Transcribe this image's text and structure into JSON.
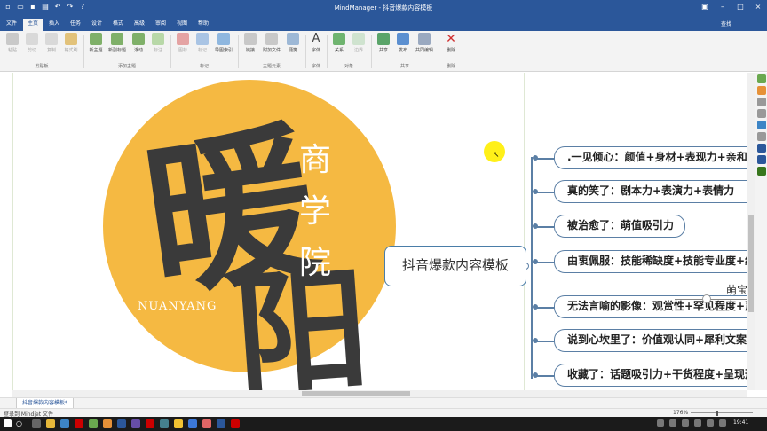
{
  "window": {
    "title": "MindManager - 抖音爆款内容模板"
  },
  "ribbon_tabs": [
    {
      "label": "文件"
    },
    {
      "label": "主页"
    },
    {
      "label": "插入"
    },
    {
      "label": "任务"
    },
    {
      "label": "设计"
    },
    {
      "label": "格式"
    },
    {
      "label": "高级"
    },
    {
      "label": "审阅"
    },
    {
      "label": "视图"
    },
    {
      "label": "帮助"
    }
  ],
  "find_label": "查找",
  "ribbon": {
    "buttons": [
      {
        "label": "粘贴"
      },
      {
        "label": "剪切"
      },
      {
        "label": "复制"
      },
      {
        "label": "格式刷"
      },
      {
        "label": "新主题"
      },
      {
        "label": "新副标题"
      },
      {
        "label": "浮动"
      },
      {
        "label": "标注"
      },
      {
        "label": "图标"
      },
      {
        "label": "标记"
      },
      {
        "label": "导图索引"
      },
      {
        "label": "链接"
      },
      {
        "label": "附加文件"
      },
      {
        "label": "便笺"
      },
      {
        "label": "字体"
      },
      {
        "label": "关系"
      },
      {
        "label": "边界"
      },
      {
        "label": "共享"
      },
      {
        "label": "发布"
      },
      {
        "label": "共同编辑"
      },
      {
        "label": "删除"
      }
    ],
    "groups": [
      {
        "label": "剪贴板"
      },
      {
        "label": "添加主题"
      },
      {
        "label": "标记"
      },
      {
        "label": "主题元素"
      },
      {
        "label": "字体"
      },
      {
        "label": "对象"
      },
      {
        "label": "共享"
      },
      {
        "label": "删除"
      }
    ]
  },
  "canvas": {
    "logo": {
      "char1": "暖",
      "char2": "阳",
      "school": "商学院",
      "brand": "NUANYANG"
    },
    "central_topic": "抖音爆款内容模板",
    "branches": [
      {
        "text": ".一见倾心：颜值+身材+表现力+亲和力"
      },
      {
        "text": "真的笑了：剧本力+表演力+表情力"
      },
      {
        "text": "被治愈了：萌值吸引力"
      },
      {
        "text": "由衷佩服：技能稀缺度+技能专业度+结"
      },
      {
        "text": "无法言喻的影像：观赏性+罕见程度+声"
      },
      {
        "text": "说到心坎里了：价值观认同+犀利文案+"
      },
      {
        "text": "收藏了：话题吸引力+干货程度+呈现形"
      }
    ],
    "subtopic": "萌宝"
  },
  "doc_tab": "抖音爆款内容模板*",
  "status": {
    "text": "登录到 Mindjet 文件",
    "zoom": "176%"
  },
  "taskbar": {
    "clock": "19:41"
  },
  "colors": {
    "accent": "#2b579a",
    "circle": "#f5b942",
    "branch_border": "#5b7fa5"
  }
}
